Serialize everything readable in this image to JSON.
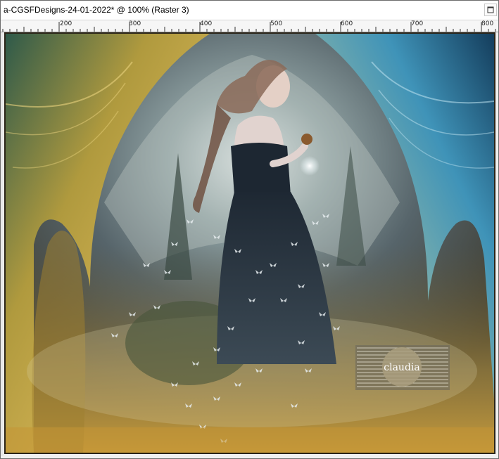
{
  "window": {
    "title": "a-CGSFDesigns-24-01-2022* @ 100% (Raster 3)"
  },
  "ruler": {
    "labels": [
      "200",
      "300",
      "400",
      "500",
      "600",
      "700",
      "800"
    ]
  },
  "watermark": {
    "text": "claudia"
  },
  "colors": {
    "gold": "#c9a24a",
    "teal": "#3f8fb0",
    "dark": "#16202a"
  }
}
